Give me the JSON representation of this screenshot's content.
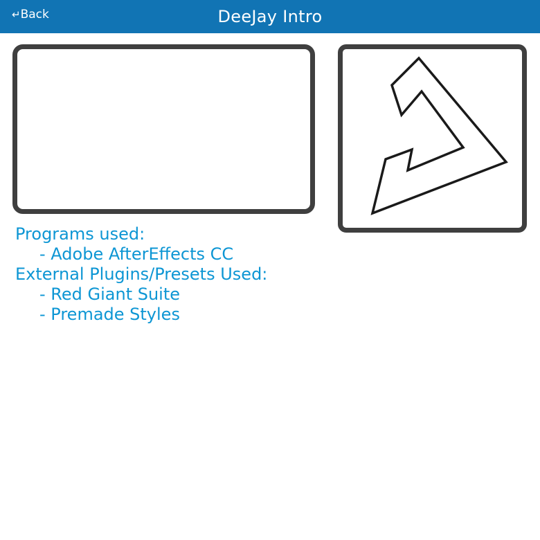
{
  "header": {
    "back_arrow": "↵",
    "back_label": "Back",
    "title": "DeeJay Intro"
  },
  "info": {
    "programs_heading": "Programs used:",
    "programs": [
      "- Adobe AfterEffects CC"
    ],
    "plugins_heading": "External Plugins/Presets Used:",
    "plugins": [
      "- Red Giant Suite",
      "- Premade Styles"
    ]
  },
  "colors": {
    "header_bg": "#1174b4",
    "header_text": "#ffffff",
    "info_text": "#0d96d4",
    "frame_border": "#3f3f3f"
  },
  "icons": {
    "logo": "deejay-logo-outline"
  }
}
